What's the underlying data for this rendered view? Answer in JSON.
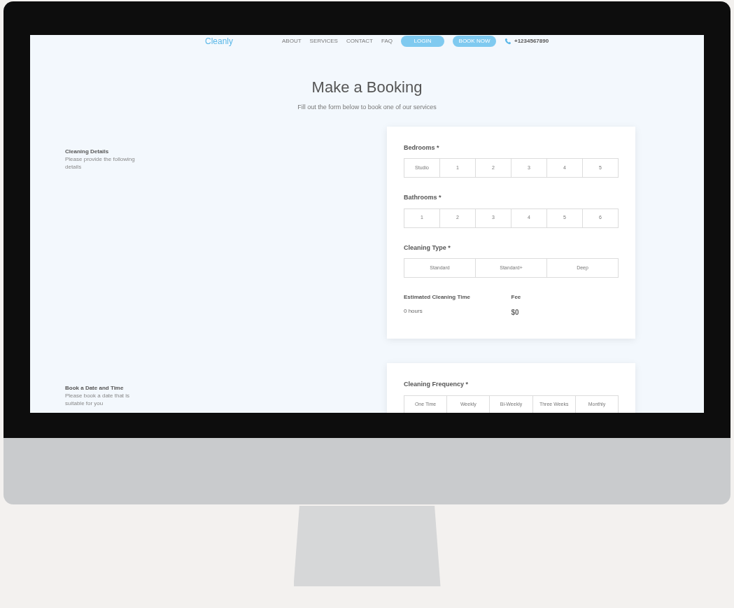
{
  "header": {
    "logo": "Cleanly",
    "nav": [
      "ABOUT",
      "SERVICES",
      "CONTACT",
      "FAQ"
    ],
    "buttons": [
      "LOGIN",
      "BOOK NOW"
    ],
    "phone": "+1234567890"
  },
  "hero": {
    "title": "Make a Booking",
    "subtitle": "Fill out the form below to book one of our services"
  },
  "sections": [
    {
      "title": "Cleaning Details",
      "description": "Please provide the following details",
      "groups": [
        {
          "label": "Bedrooms *",
          "options": [
            {
              "label": "Studio",
              "selected": false
            },
            {
              "label": "1",
              "selected": false
            },
            {
              "label": "2",
              "selected": false
            },
            {
              "label": "3",
              "selected": false
            },
            {
              "label": "4",
              "selected": false
            },
            {
              "label": "5",
              "selected": false
            }
          ]
        },
        {
          "label": "Bathrooms *",
          "options": [
            {
              "label": "1",
              "selected": false
            },
            {
              "label": "2",
              "selected": false
            },
            {
              "label": "3",
              "selected": false
            },
            {
              "label": "4",
              "selected": false
            },
            {
              "label": "5",
              "selected": false
            },
            {
              "label": "6",
              "selected": false
            }
          ]
        },
        {
          "label": "Cleaning Type *",
          "options": [
            {
              "label": "Standard",
              "selected": false
            },
            {
              "label": "Standard+",
              "selected": false
            },
            {
              "label": "Deep",
              "selected": false
            }
          ]
        }
      ],
      "summary": [
        {
          "label": "Estimated Cleaning Time",
          "value": "0 hours"
        },
        {
          "label": "Fee",
          "value": "$0"
        }
      ]
    },
    {
      "title": "Book a Date and Time",
      "description": "Please book a date that is suitable for you",
      "groups": [
        {
          "label": "Cleaning Frequency *",
          "options": [
            {
              "label": "One Time",
              "selected": false
            },
            {
              "label": "Weekly",
              "selected": false
            },
            {
              "label": "Bi-Weekly",
              "selected": false
            },
            {
              "label": "Three Weeks",
              "selected": false
            },
            {
              "label": "Monthly",
              "selected": false
            }
          ]
        }
      ]
    }
  ]
}
